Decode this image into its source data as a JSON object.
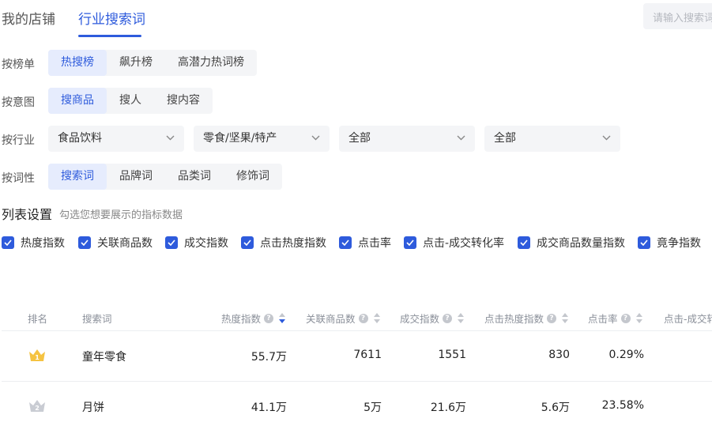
{
  "tabs": [
    {
      "label": "我的店铺"
    },
    {
      "label": "行业搜索词"
    }
  ],
  "search": {
    "placeholder": "请输入搜索词"
  },
  "filters": {
    "rank": {
      "label": "按榜单",
      "options": [
        {
          "label": "热搜榜"
        },
        {
          "label": "飙升榜"
        },
        {
          "label": "高潜力热词榜"
        }
      ]
    },
    "intent": {
      "label": "按意图",
      "options": [
        {
          "label": "搜商品"
        },
        {
          "label": "搜人"
        },
        {
          "label": "搜内容"
        }
      ]
    },
    "industry": {
      "label": "按行业",
      "selects": [
        {
          "value": "食品饮料"
        },
        {
          "value": "零食/坚果/特产"
        },
        {
          "value": "全部"
        },
        {
          "value": "全部"
        }
      ]
    },
    "word_type": {
      "label": "按词性",
      "options": [
        {
          "label": "搜索词"
        },
        {
          "label": "品牌词"
        },
        {
          "label": "品类词"
        },
        {
          "label": "修饰词"
        }
      ]
    }
  },
  "list_settings": {
    "title": "列表设置",
    "hint": "勾选您想要展示的指标数据",
    "metrics": [
      {
        "label": "热度指数"
      },
      {
        "label": "关联商品数"
      },
      {
        "label": "成交指数"
      },
      {
        "label": "点击热度指数"
      },
      {
        "label": "点击率"
      },
      {
        "label": "点击-成交转化率"
      },
      {
        "label": "成交商品数量指数"
      },
      {
        "label": "竟争指数"
      }
    ]
  },
  "table": {
    "headers": {
      "rank": "排名",
      "keyword": "搜索词",
      "heat": "热度指数",
      "products": "关联商品数",
      "deals": "成交指数",
      "click_heat": "点击热度指数",
      "ctr": "点击率",
      "conversion": "点击-成交转"
    },
    "rows": [
      {
        "rank": "1",
        "keyword": "童年零食",
        "heat": "55.7万",
        "products": "7611",
        "deals": "1551",
        "click_heat": "830",
        "ctr": "0.29%"
      },
      {
        "rank": "2",
        "keyword": "月饼",
        "heat": "41.1万",
        "products": "5万",
        "deals": "21.6万",
        "click_heat": "5.6万",
        "ctr": "23.58%"
      }
    ]
  },
  "colors": {
    "accent": "#2e5bdc",
    "gold": "#f5c342",
    "silver": "#c9ccd3"
  }
}
